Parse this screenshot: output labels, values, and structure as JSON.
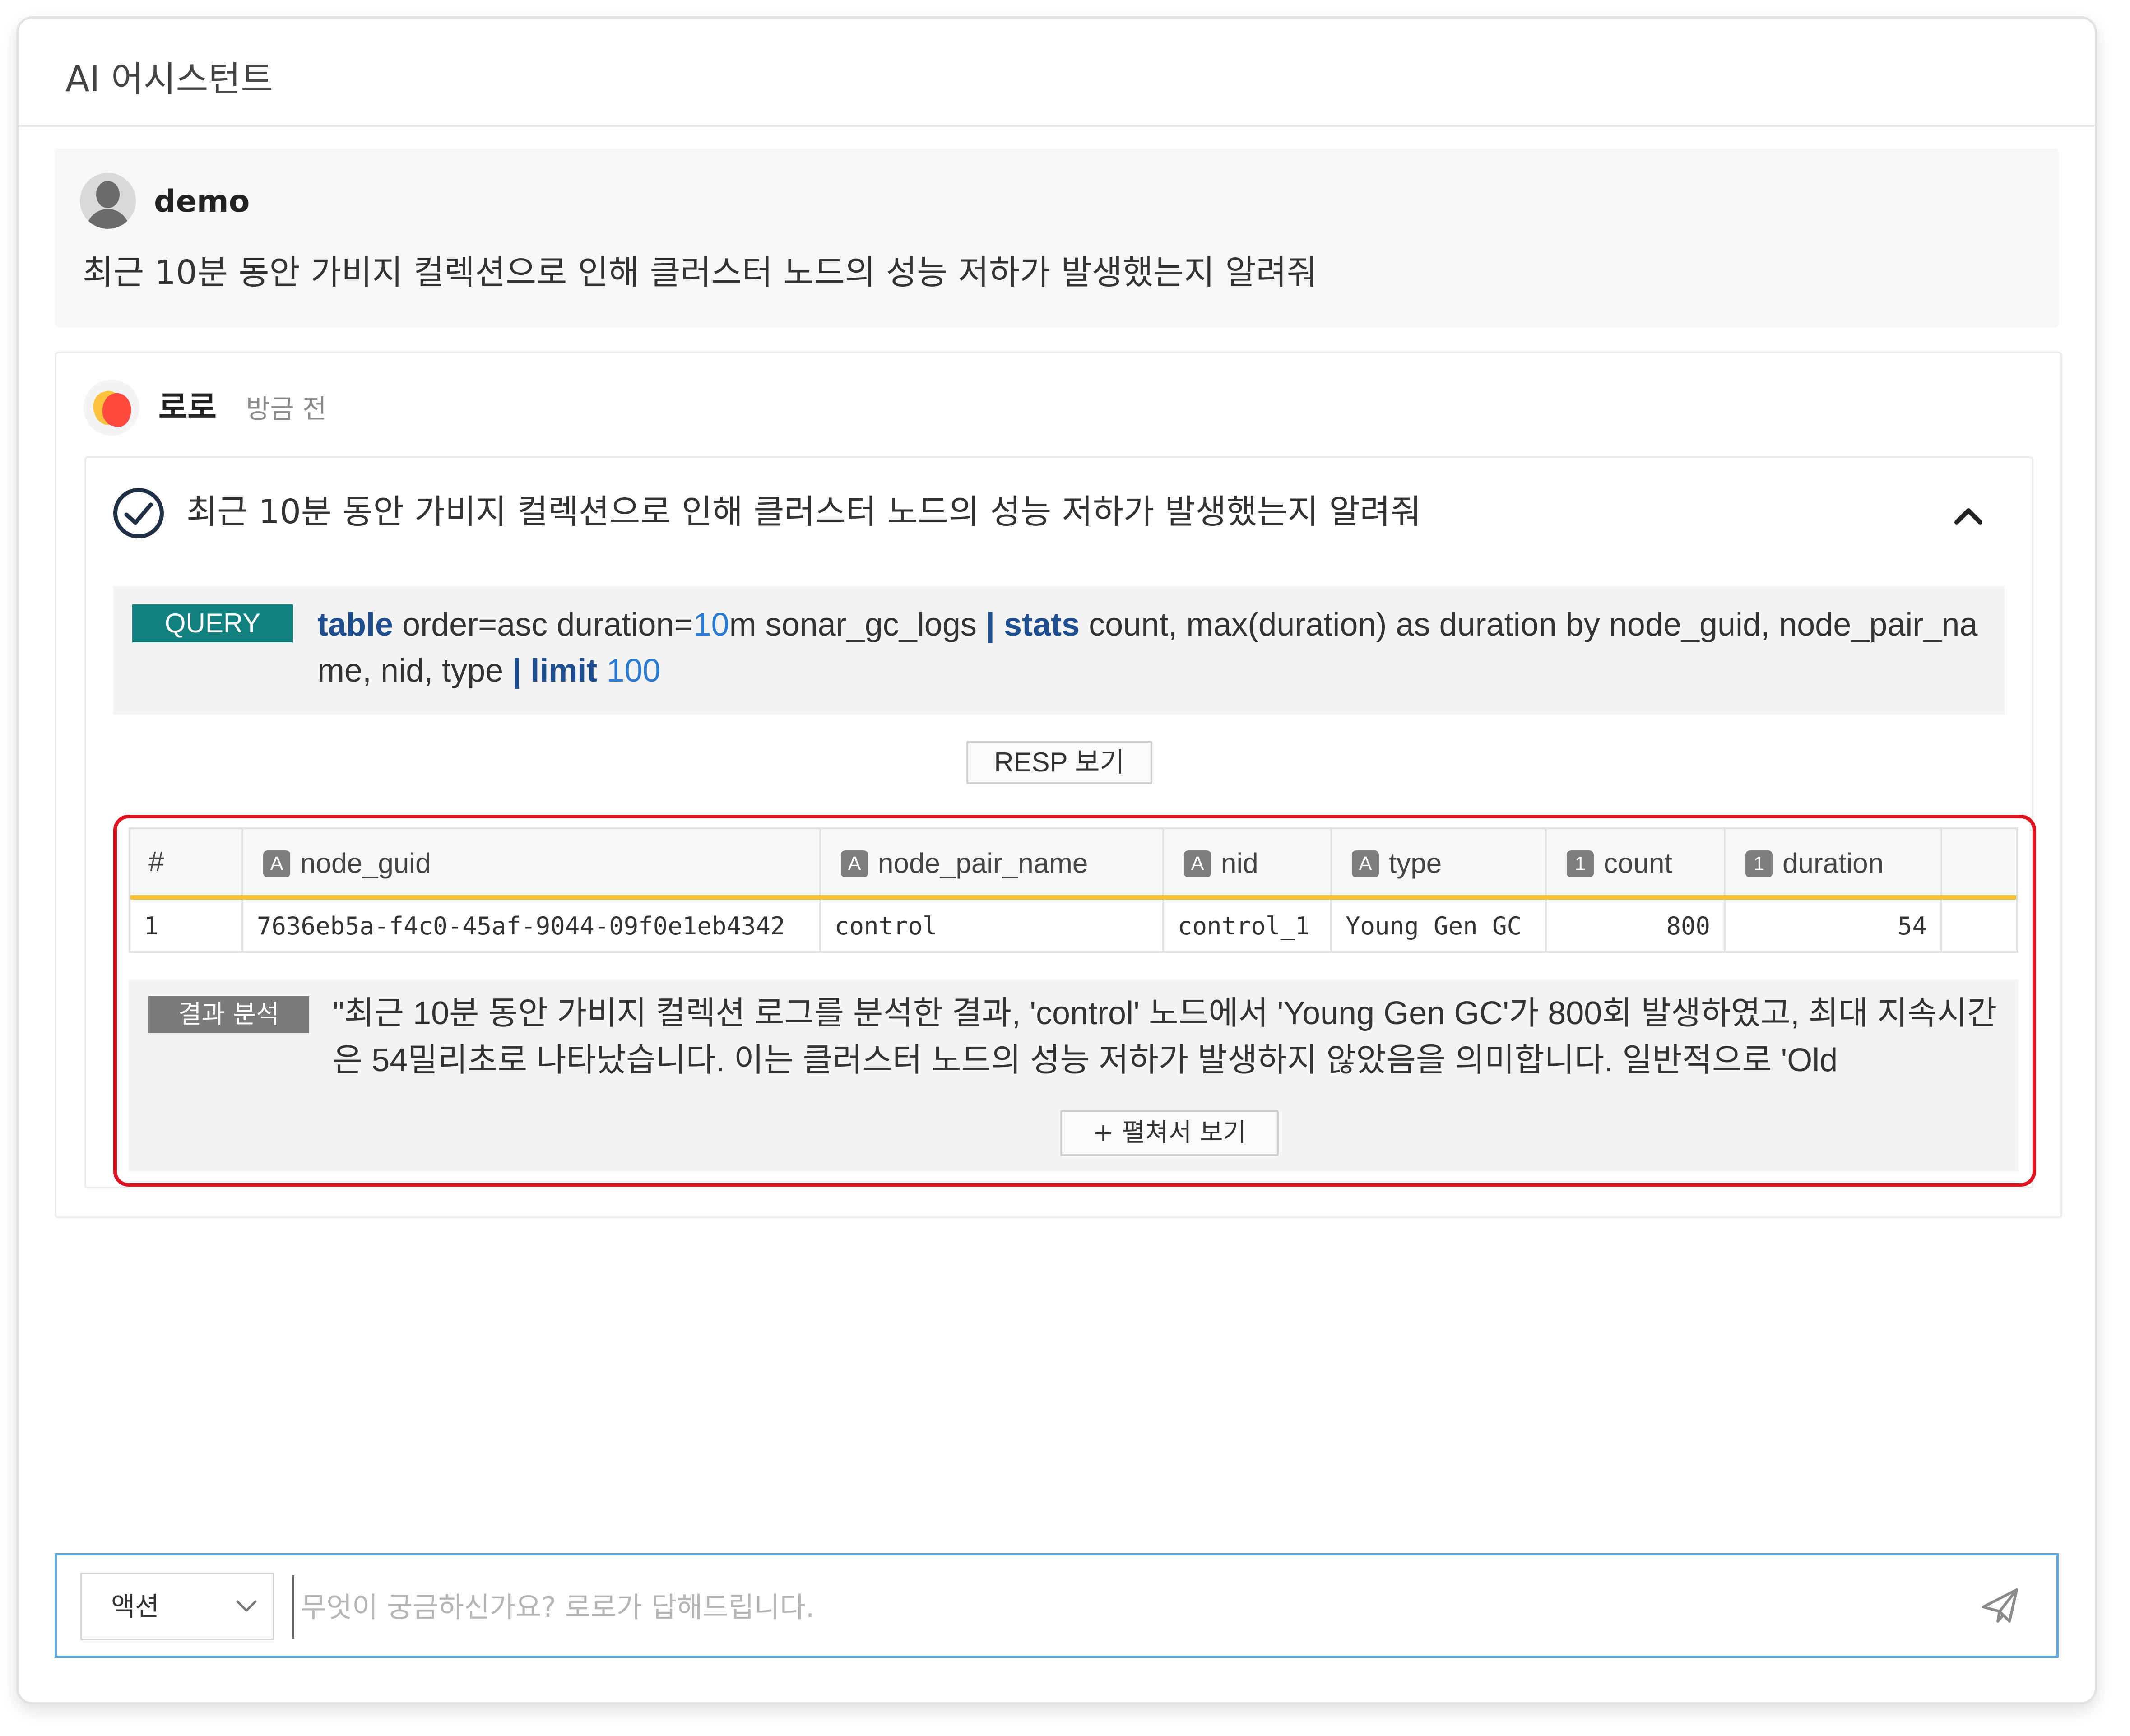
{
  "header": {
    "title": "AI 어시스턴트"
  },
  "user_message": {
    "name": "demo",
    "text": "최근 10분 동안 가비지 컬렉션으로 인해 클러스터 노드의 성능 저하가 발생했는지 알려줘"
  },
  "bot_message": {
    "name": "로로",
    "time": "방금 전",
    "task": {
      "title": "최근 10분 동안 가비지 컬렉션으로 인해 클러스터 노드의 성능 저하가 발생했는지 알려줘",
      "query_badge": "QUERY",
      "query": {
        "kw1": "table",
        "t1": " order=asc duration=",
        "n1": "10",
        "t2": "m sonar_gc_logs ",
        "pipe1": "|",
        "kw2": " stats",
        "t3": " count, max(duration) as duration by node_guid, node_pair_name, nid, type ",
        "pipe2": "|",
        "kw3": " limit",
        "n2": " 100"
      },
      "resp_button": "RESP 보기",
      "table": {
        "columns": [
          {
            "label": "#",
            "type_icon": ""
          },
          {
            "label": "node_guid",
            "type_icon": "A"
          },
          {
            "label": "node_pair_name",
            "type_icon": "A"
          },
          {
            "label": "nid",
            "type_icon": "A"
          },
          {
            "label": "type",
            "type_icon": "A"
          },
          {
            "label": "count",
            "type_icon": "1"
          },
          {
            "label": "duration",
            "type_icon": "1"
          }
        ],
        "rows": [
          [
            "1",
            "7636eb5a-f4c0-45af-9044-09f0e1eb4342",
            "control",
            "control_1",
            "Young Gen GC",
            "800",
            "54"
          ]
        ]
      },
      "analysis_badge": "결과 분석",
      "analysis_text": "\"최근 10분 동안 가비지 컬렉션 로그를 분석한 결과, 'control' 노드에서 'Young Gen GC'가 800회 발생하였고, 최대 지속시간은 54밀리초로 나타났습니다. 이는 클러스터 노드의 성능 저하가 발생하지 않았음을 의미합니다. 일반적으로 'Old",
      "expand_button": "+ 펼쳐서 보기"
    }
  },
  "input": {
    "action_select": "액션",
    "placeholder": "무엇이 궁금하신가요? 로로가 답해드립니다."
  },
  "colors": {
    "query_badge": "#138080",
    "keyword": "#1f4e8f",
    "number": "#2a7bd4",
    "header_underline": "#f3c233",
    "highlight": "#e0141e",
    "input_border": "#5ba7e2"
  }
}
